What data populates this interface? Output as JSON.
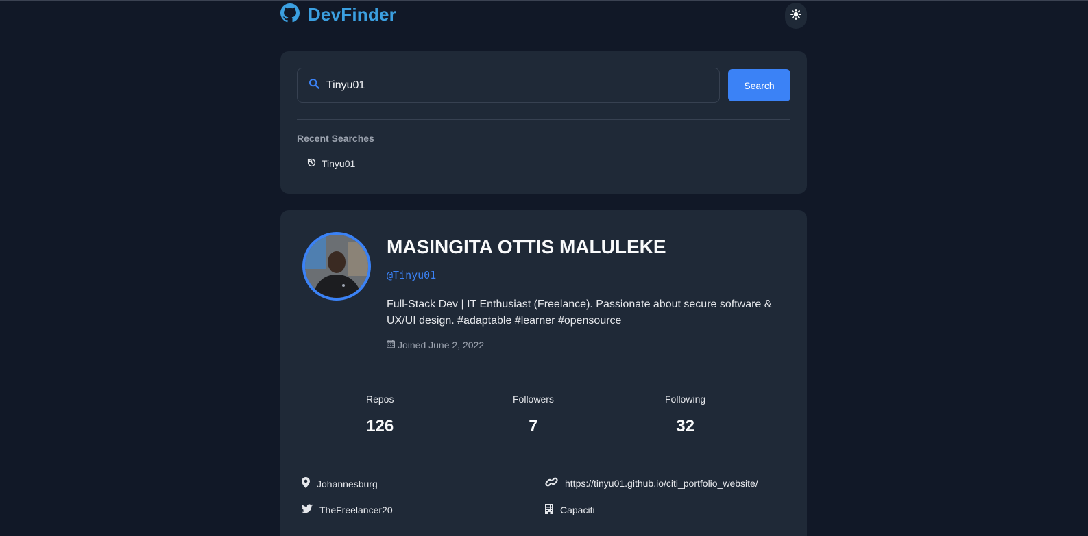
{
  "header": {
    "logo_icon": "github-icon",
    "app_name": "DevFinder",
    "theme_toggle_icon": "sun-icon"
  },
  "search": {
    "value": "Tinyu01",
    "placeholder": "",
    "button_label": "Search",
    "recent_title": "Recent Searches",
    "recent": [
      {
        "label": "Tinyu01",
        "icon": "history-icon"
      }
    ]
  },
  "profile": {
    "name": "MASINGITA OTTIS MALULEKE",
    "handle": "@Tinyu01",
    "bio": "Full-Stack Dev | IT Enthusiast (Freelance). Passionate about secure software & UX/UI design. #adaptable #learner #opensource",
    "joined": "Joined June 2, 2022",
    "stats": {
      "repos_label": "Repos",
      "repos": "126",
      "followers_label": "Followers",
      "followers": "7",
      "following_label": "Following",
      "following": "32"
    },
    "location": "Johannesburg",
    "website": "https://tinyu01.github.io/citi_portfolio_website/",
    "twitter": "TheFreelancer20",
    "company": "Capaciti"
  },
  "colors": {
    "background": "#111827",
    "card": "#1f2937",
    "accent": "#3b82f6",
    "logo": "#3b9fe0"
  }
}
